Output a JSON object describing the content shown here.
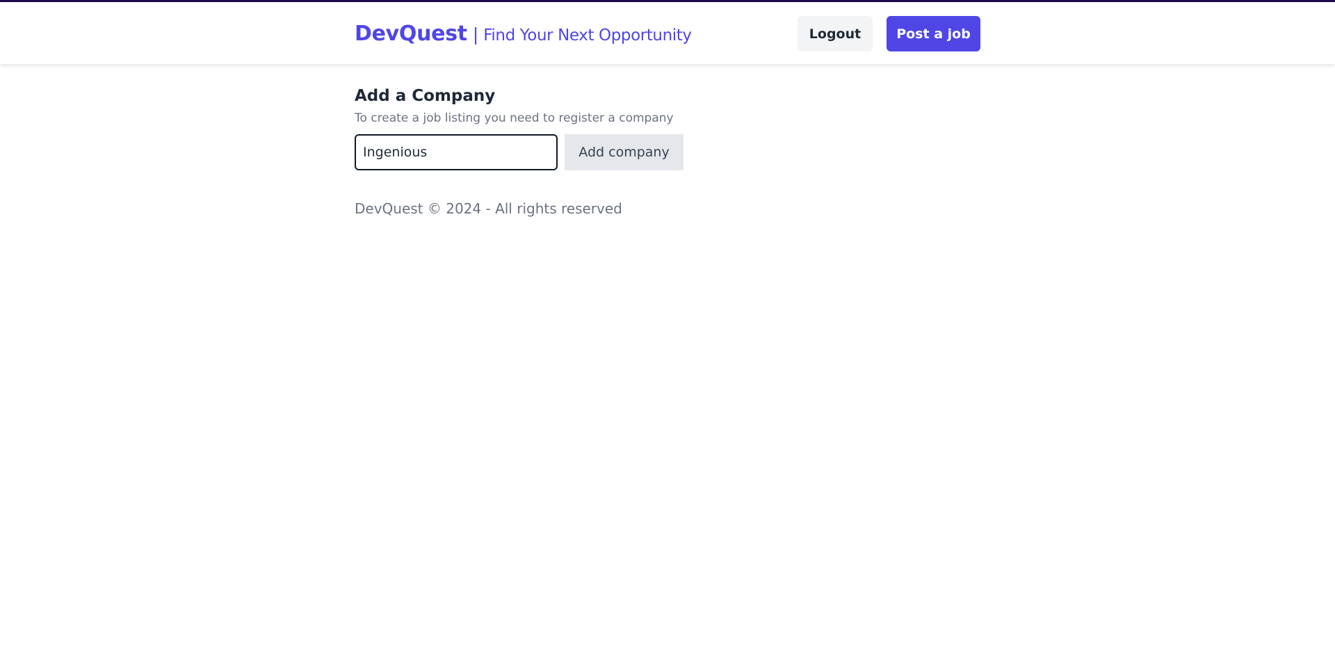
{
  "header": {
    "brand_name": "DevQuest",
    "separator": "|",
    "tagline": "Find Your Next Opportunity",
    "logout_label": "Logout",
    "post_job_label": "Post a job"
  },
  "main": {
    "title": "Add a Company",
    "subtitle": "To create a job listing you need to register a company",
    "company_input_value": "Ingenious",
    "add_company_label": "Add company"
  },
  "footer": {
    "text": "DevQuest © 2024 - All rights reserved"
  },
  "colors": {
    "brand": "#4f46e5",
    "top_line": "#1e0b4b",
    "muted_text": "#6b7280"
  }
}
